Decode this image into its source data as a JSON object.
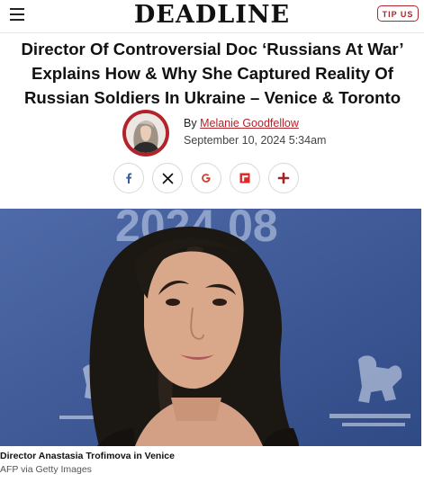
{
  "header": {
    "logo": "DEADLINE",
    "tip_button": "TIP US"
  },
  "article": {
    "headline": "Director Of Controversial Doc ‘Russians At War’ Explains How & Why She Captured Reality Of Russian Soldiers In Ukraine – Venice & Toronto",
    "byline_prefix": "By",
    "author": "Melanie Goodfellow",
    "date": "September 10, 2024 5:34am"
  },
  "share": [
    "facebook-icon",
    "x-icon",
    "google-icon",
    "flipboard-icon",
    "plus-icon"
  ],
  "photo": {
    "backdrop_text": "2024 08",
    "caption": "Director Anastasia Trofimova in Venice",
    "credit": "AFP via Getty Images"
  },
  "colors": {
    "brand_red": "#b0242c",
    "backdrop_blue": "#39528f"
  }
}
